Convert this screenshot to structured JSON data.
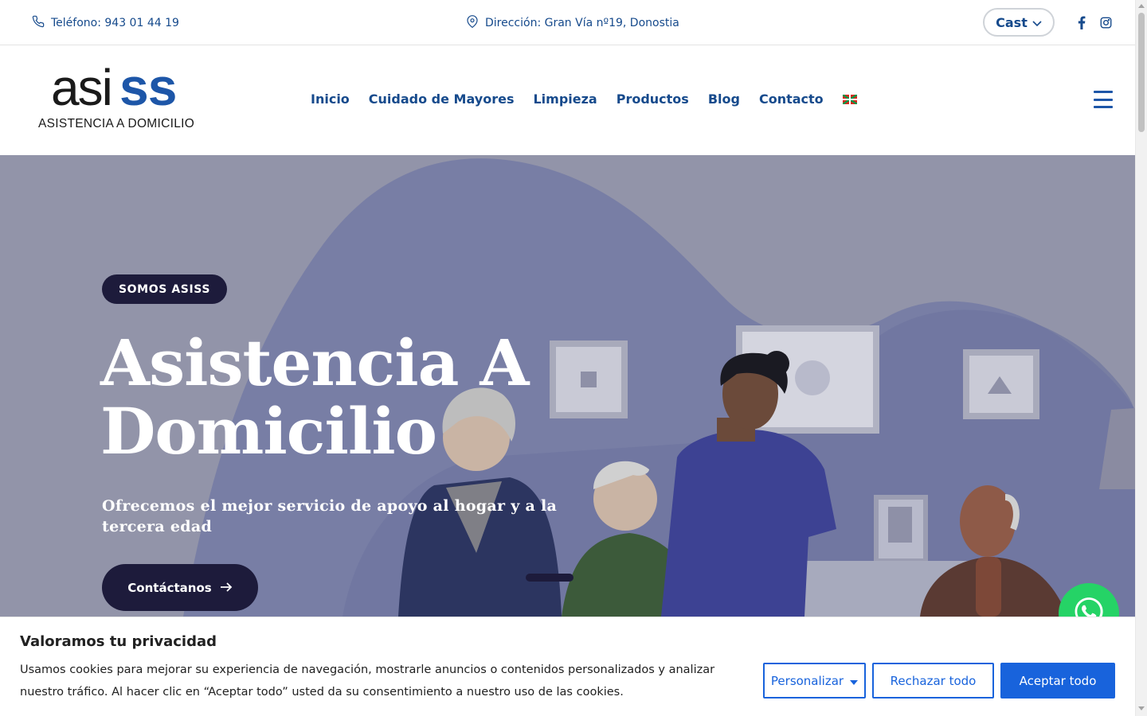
{
  "topbar": {
    "phone_text": "Teléfono: 943 01 44 19",
    "address_text": "Dirección: Gran Vía nº19, Donostia",
    "language_label": "Cast",
    "social": [
      "facebook-icon",
      "instagram-icon"
    ]
  },
  "header": {
    "logo_main_left": "asi",
    "logo_main_right": "ss",
    "logo_subtitle": "ASISTENCIA A DOMICILIO",
    "nav": [
      "Inicio",
      "Cuidado de Mayores",
      "Limpieza",
      "Productos",
      "Blog",
      "Contacto"
    ]
  },
  "hero": {
    "badge": "SOMOS ASISS",
    "title_line1": "Asistencia A",
    "title_line2": "Domicilio",
    "subtitle": "Ofrecemos el mejor servicio de apoyo al hogar y a la tercera edad",
    "cta_label": "Contáctanos"
  },
  "cookie": {
    "title": "Valoramos tu privacidad",
    "text": "Usamos cookies para mejorar su experiencia de navegación, mostrarle anuncios o contenidos personalizados y analizar nuestro tráfico. Al hacer clic en “Aceptar todo” usted da su consentimiento a nuestro uso de las cookies.",
    "customize_label": "Personalizar",
    "reject_label": "Rechazar todo",
    "accept_label": "Aceptar todo"
  },
  "colors": {
    "brand_blue": "#164a8c",
    "logo_blue": "#1d56a8",
    "hero_bg": "#9294a9",
    "dark_button": "#1d1b3b",
    "cookie_blue": "#1863dc",
    "whatsapp_green": "#25d366"
  }
}
